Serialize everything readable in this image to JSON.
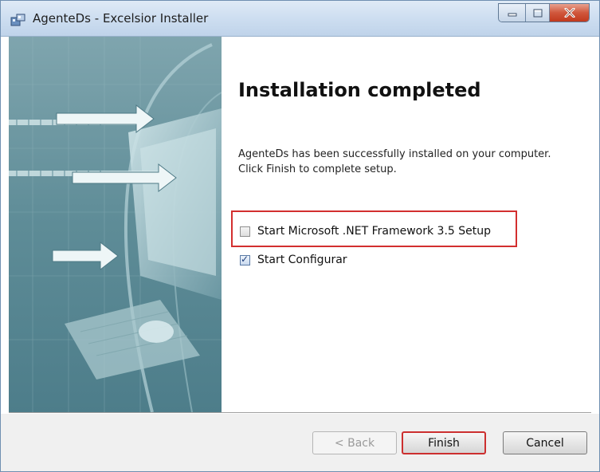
{
  "window": {
    "title": "AgenteDs - Excelsior Installer",
    "icon": "installer-icon"
  },
  "caption_buttons": {
    "minimize_icon": "minimize-icon",
    "maximize_icon": "maximize-icon",
    "close_icon": "close-icon"
  },
  "content": {
    "heading": "Installation completed",
    "message": "AgenteDs  has been successfully installed on your computer. Click Finish to complete setup."
  },
  "options": [
    {
      "label": "Start Microsoft .NET Framework 3.5 Setup",
      "checked": false
    },
    {
      "label": "Start Configurar",
      "checked": true
    }
  ],
  "buttons": {
    "back": "< Back",
    "finish": "Finish",
    "cancel": "Cancel"
  },
  "colors": {
    "highlight": "#d32f2f",
    "close_button": "#c1391d",
    "banner_tint": "#5f8a96"
  }
}
